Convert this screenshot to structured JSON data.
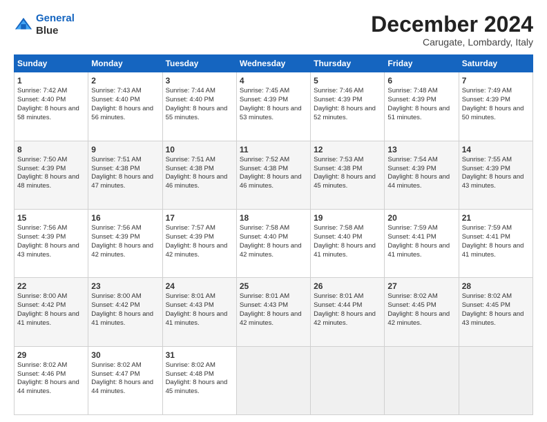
{
  "logo": {
    "line1": "General",
    "line2": "Blue"
  },
  "title": "December 2024",
  "location": "Carugate, Lombardy, Italy",
  "weekdays": [
    "Sunday",
    "Monday",
    "Tuesday",
    "Wednesday",
    "Thursday",
    "Friday",
    "Saturday"
  ],
  "weeks": [
    [
      {
        "day": "1",
        "sunrise": "7:42 AM",
        "sunset": "4:40 PM",
        "daylight": "8 hours and 58 minutes."
      },
      {
        "day": "2",
        "sunrise": "7:43 AM",
        "sunset": "4:40 PM",
        "daylight": "8 hours and 56 minutes."
      },
      {
        "day": "3",
        "sunrise": "7:44 AM",
        "sunset": "4:40 PM",
        "daylight": "8 hours and 55 minutes."
      },
      {
        "day": "4",
        "sunrise": "7:45 AM",
        "sunset": "4:39 PM",
        "daylight": "8 hours and 53 minutes."
      },
      {
        "day": "5",
        "sunrise": "7:46 AM",
        "sunset": "4:39 PM",
        "daylight": "8 hours and 52 minutes."
      },
      {
        "day": "6",
        "sunrise": "7:48 AM",
        "sunset": "4:39 PM",
        "daylight": "8 hours and 51 minutes."
      },
      {
        "day": "7",
        "sunrise": "7:49 AM",
        "sunset": "4:39 PM",
        "daylight": "8 hours and 50 minutes."
      }
    ],
    [
      {
        "day": "8",
        "sunrise": "7:50 AM",
        "sunset": "4:39 PM",
        "daylight": "8 hours and 48 minutes."
      },
      {
        "day": "9",
        "sunrise": "7:51 AM",
        "sunset": "4:38 PM",
        "daylight": "8 hours and 47 minutes."
      },
      {
        "day": "10",
        "sunrise": "7:51 AM",
        "sunset": "4:38 PM",
        "daylight": "8 hours and 46 minutes."
      },
      {
        "day": "11",
        "sunrise": "7:52 AM",
        "sunset": "4:38 PM",
        "daylight": "8 hours and 46 minutes."
      },
      {
        "day": "12",
        "sunrise": "7:53 AM",
        "sunset": "4:38 PM",
        "daylight": "8 hours and 45 minutes."
      },
      {
        "day": "13",
        "sunrise": "7:54 AM",
        "sunset": "4:39 PM",
        "daylight": "8 hours and 44 minutes."
      },
      {
        "day": "14",
        "sunrise": "7:55 AM",
        "sunset": "4:39 PM",
        "daylight": "8 hours and 43 minutes."
      }
    ],
    [
      {
        "day": "15",
        "sunrise": "7:56 AM",
        "sunset": "4:39 PM",
        "daylight": "8 hours and 43 minutes."
      },
      {
        "day": "16",
        "sunrise": "7:56 AM",
        "sunset": "4:39 PM",
        "daylight": "8 hours and 42 minutes."
      },
      {
        "day": "17",
        "sunrise": "7:57 AM",
        "sunset": "4:39 PM",
        "daylight": "8 hours and 42 minutes."
      },
      {
        "day": "18",
        "sunrise": "7:58 AM",
        "sunset": "4:40 PM",
        "daylight": "8 hours and 42 minutes."
      },
      {
        "day": "19",
        "sunrise": "7:58 AM",
        "sunset": "4:40 PM",
        "daylight": "8 hours and 41 minutes."
      },
      {
        "day": "20",
        "sunrise": "7:59 AM",
        "sunset": "4:41 PM",
        "daylight": "8 hours and 41 minutes."
      },
      {
        "day": "21",
        "sunrise": "7:59 AM",
        "sunset": "4:41 PM",
        "daylight": "8 hours and 41 minutes."
      }
    ],
    [
      {
        "day": "22",
        "sunrise": "8:00 AM",
        "sunset": "4:42 PM",
        "daylight": "8 hours and 41 minutes."
      },
      {
        "day": "23",
        "sunrise": "8:00 AM",
        "sunset": "4:42 PM",
        "daylight": "8 hours and 41 minutes."
      },
      {
        "day": "24",
        "sunrise": "8:01 AM",
        "sunset": "4:43 PM",
        "daylight": "8 hours and 41 minutes."
      },
      {
        "day": "25",
        "sunrise": "8:01 AM",
        "sunset": "4:43 PM",
        "daylight": "8 hours and 42 minutes."
      },
      {
        "day": "26",
        "sunrise": "8:01 AM",
        "sunset": "4:44 PM",
        "daylight": "8 hours and 42 minutes."
      },
      {
        "day": "27",
        "sunrise": "8:02 AM",
        "sunset": "4:45 PM",
        "daylight": "8 hours and 42 minutes."
      },
      {
        "day": "28",
        "sunrise": "8:02 AM",
        "sunset": "4:45 PM",
        "daylight": "8 hours and 43 minutes."
      }
    ],
    [
      {
        "day": "29",
        "sunrise": "8:02 AM",
        "sunset": "4:46 PM",
        "daylight": "8 hours and 44 minutes."
      },
      {
        "day": "30",
        "sunrise": "8:02 AM",
        "sunset": "4:47 PM",
        "daylight": "8 hours and 44 minutes."
      },
      {
        "day": "31",
        "sunrise": "8:02 AM",
        "sunset": "4:48 PM",
        "daylight": "8 hours and 45 minutes."
      },
      null,
      null,
      null,
      null
    ]
  ],
  "labels": {
    "sunrise": "Sunrise:",
    "sunset": "Sunset:",
    "daylight": "Daylight:"
  }
}
